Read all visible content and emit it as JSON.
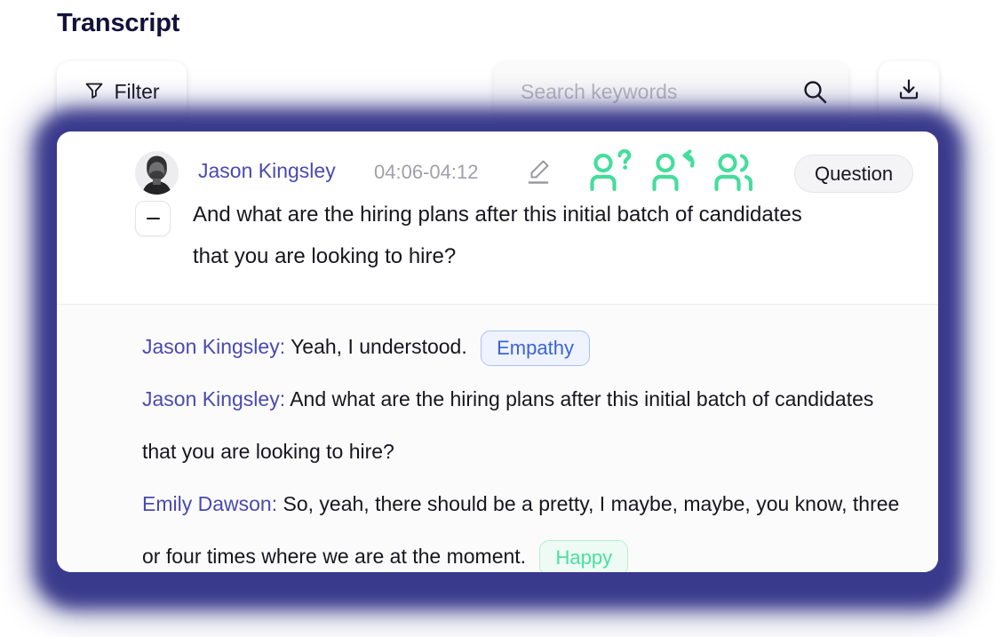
{
  "page": {
    "title": "Transcript"
  },
  "toolbar": {
    "filter_label": "Filter",
    "filter_icon": "funnel-icon",
    "search_placeholder": "Search keywords",
    "search_value": "",
    "search_icon": "search-icon",
    "download_icon": "download-icon"
  },
  "entry": {
    "speaker": "Jason Kingsley",
    "timestamp": "04:06-04:12",
    "edit_icon": "pencil-edit-icon",
    "tag_icons": [
      "person-question-icon",
      "person-reply-icon",
      "person-group-icon"
    ],
    "category_badge": "Question",
    "collapse_icon": "minus-collapse-icon",
    "summary": "And what are the hiring plans after this initial batch of candidates that you are looking to hire?"
  },
  "utterances": [
    {
      "speaker": "Jason Kingsley:",
      "text": "Yeah, I understood.",
      "chip": "Empathy",
      "chip_type": "empathy"
    },
    {
      "speaker": "Jason Kingsley:",
      "text": "And what are the hiring plans after this initial batch of candidates that you are looking to hire?",
      "chip": "",
      "chip_type": ""
    },
    {
      "speaker": "Emily Dawson:",
      "text": "So, yeah, there should be a pretty, I maybe, maybe, you know, three or four times where we are at the moment.",
      "chip": "Happy",
      "chip_type": "happy"
    }
  ],
  "colors": {
    "glow": "#3a3a8c",
    "speaker": "#4a4ab0",
    "green_icon": "#45dd9c",
    "empathy_text": "#3b63d8",
    "happy_text": "#47dfa0"
  }
}
